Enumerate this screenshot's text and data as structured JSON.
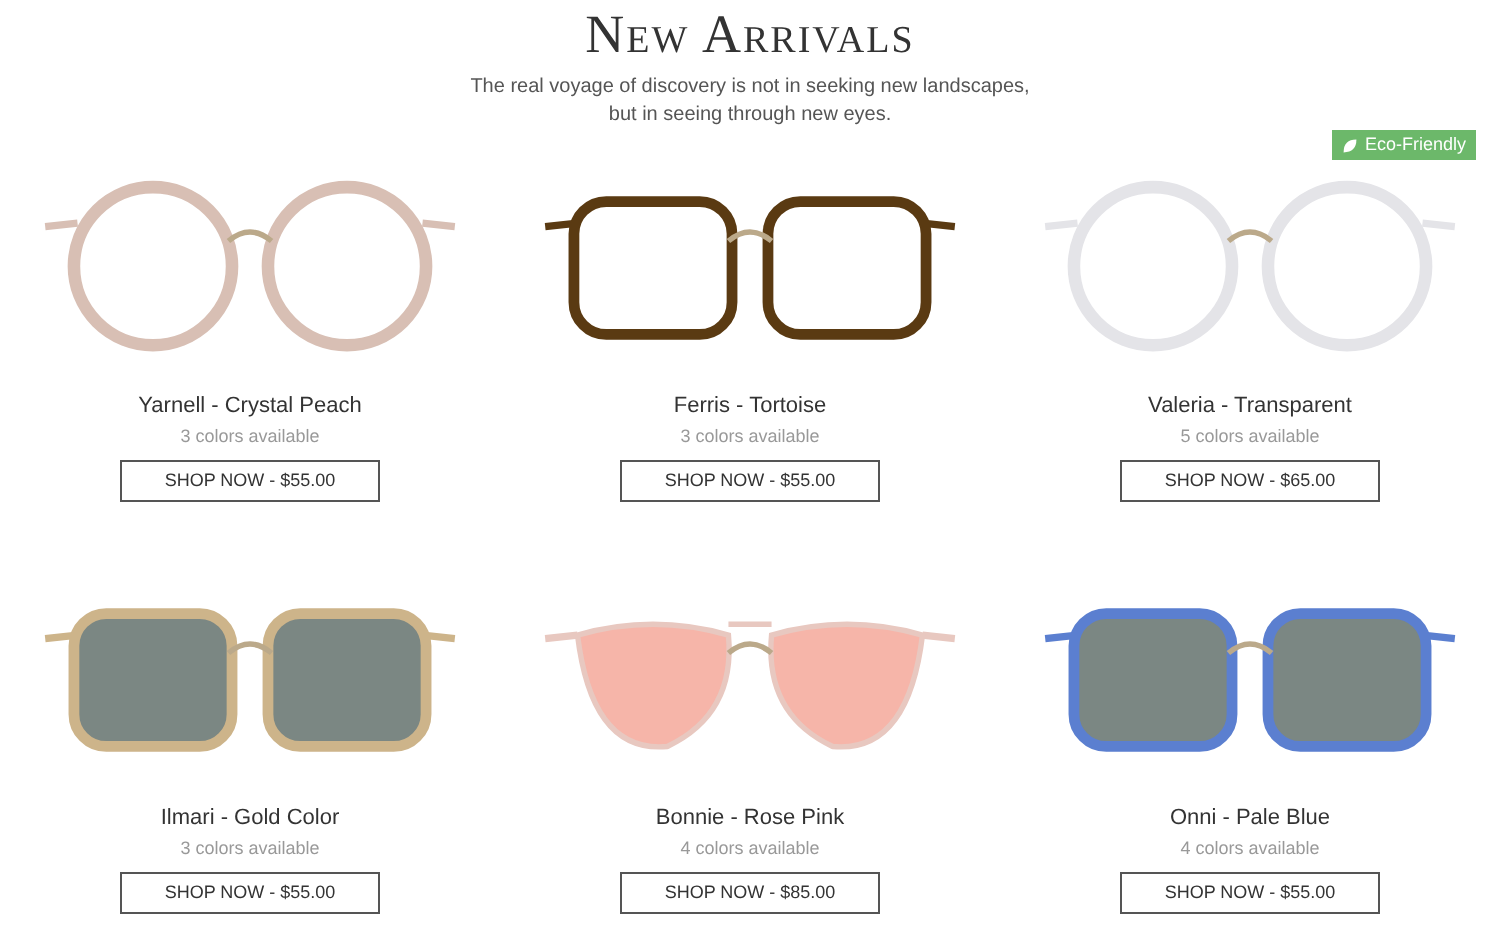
{
  "heading": {
    "title": "New Arrivals",
    "subtitle_lines": [
      "The real voyage of discovery is not in seeking new landscapes,",
      "but in seeing through new eyes."
    ]
  },
  "products": [
    {
      "name": "Yarnell - Crystal Peach",
      "colors": "3 colors available",
      "button": "SHOP NOW - $55.00",
      "color": "#d8bfb4",
      "kind": "round"
    },
    {
      "name": "Ferris - Tortoise",
      "colors": "3 colors available",
      "button": "SHOP NOW - $55.00",
      "color": "#5a3a12",
      "kind": "square"
    },
    {
      "name": "Valeria - Transparent",
      "colors": "5 colors available",
      "button": "SHOP NOW - $65.00",
      "color": "#e4e4e8",
      "kind": "round",
      "badge": "Eco-Friendly"
    },
    {
      "name": "Ilmari - Gold Color",
      "colors": "3 colors available",
      "button": "SHOP NOW - $55.00",
      "color": "#cdb48a",
      "kind": "sunglass"
    },
    {
      "name": "Bonnie - Rose Pink",
      "colors": "4 colors available",
      "button": "SHOP NOW - $85.00",
      "color": "#e8c8c0",
      "kind": "aviator"
    },
    {
      "name": "Onni - Pale Blue",
      "colors": "4 colors available",
      "button": "SHOP NOW - $55.00",
      "color": "#5b7fd0",
      "kind": "sunglass"
    }
  ]
}
